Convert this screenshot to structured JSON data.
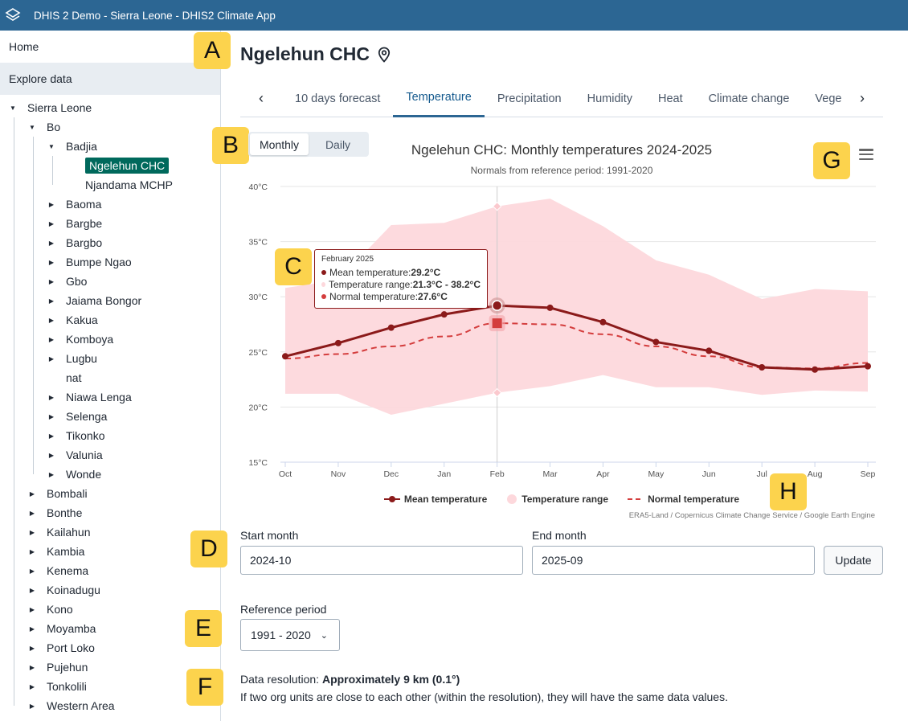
{
  "header": {
    "title": "DHIS 2 Demo - Sierra Leone - DHIS2 Climate App"
  },
  "sidebar": {
    "home": "Home",
    "explore": "Explore data",
    "tree": {
      "root": "Sierra Leone",
      "bo": "Bo",
      "badjia": "Badjia",
      "ngelehun": "Ngelehun CHC",
      "njandama": "Njandama MCHP",
      "bo_children": [
        "Baoma",
        "Bargbe",
        "Bargbo",
        "Bumpe Ngao",
        "Gbo",
        "Jaiama Bongor",
        "Kakua",
        "Komboya",
        "Lugbu",
        "nat",
        "Niawa Lenga",
        "Selenga",
        "Tikonko",
        "Valunia",
        "Wonde"
      ],
      "districts": [
        "Bombali",
        "Bonthe",
        "Kailahun",
        "Kambia",
        "Kenema",
        "Koinadugu",
        "Kono",
        "Moyamba",
        "Port Loko",
        "Pujehun",
        "Tonkolili",
        "Western Area"
      ]
    }
  },
  "badges": [
    "A",
    "B",
    "C",
    "D",
    "E",
    "F",
    "G",
    "H"
  ],
  "main": {
    "title": "Ngelehun CHC",
    "tabs": [
      "10 days forecast",
      "Temperature",
      "Precipitation",
      "Humidity",
      "Heat",
      "Climate change",
      "Vegeta"
    ],
    "active_tab": "Temperature",
    "toggle": {
      "monthly": "Monthly",
      "daily": "Daily"
    },
    "start_label": "Start month",
    "start_value": "2024-10",
    "end_label": "End month",
    "end_value": "2025-09",
    "update": "Update",
    "ref_label": "Reference period",
    "ref_value": "1991 - 2020",
    "res_prefix": "Data resolution: ",
    "res_value": "Approximately 9 km (0.1°)",
    "res_note": "If two org units are close to each other (within the resolution), they will have the same data values."
  },
  "tooltip": {
    "head": "February 2025",
    "mean_label": "Mean temperature: ",
    "mean_value": "29.2°C",
    "range_label": "Temperature range: ",
    "range_value": "21.3°C - 38.2°C",
    "normal_label": "Normal temperature: ",
    "normal_value": "27.6°C"
  },
  "colors": {
    "mean": "#8b1a1a",
    "range": "#fdd8dc",
    "normal": "#d43d3d",
    "header": "#2c6693",
    "selected": "#00695c"
  },
  "chart_data": {
    "type": "line",
    "title": "Ngelehun CHC: Monthly temperatures 2024-2025",
    "subtitle": "Normals from reference period: 1991-2020",
    "categories": [
      "Oct",
      "Nov",
      "Dec",
      "Jan",
      "Feb",
      "Mar",
      "Apr",
      "May",
      "Jun",
      "Jul",
      "Aug",
      "Sep"
    ],
    "yticks": [
      "15°C",
      "20°C",
      "25°C",
      "30°C",
      "35°C",
      "40°C"
    ],
    "ylim": [
      15,
      40
    ],
    "series": [
      {
        "name": "Mean temperature",
        "values": [
          24.6,
          25.8,
          27.2,
          28.4,
          29.2,
          29.0,
          27.7,
          25.9,
          25.1,
          23.6,
          23.4,
          23.7
        ]
      },
      {
        "name": "Temperature range",
        "low": [
          21.2,
          21.2,
          19.3,
          20.3,
          21.3,
          21.9,
          22.9,
          21.8,
          21.8,
          21.1,
          21.5,
          21.4
        ],
        "high": [
          30.8,
          31.5,
          36.5,
          36.7,
          38.2,
          38.9,
          36.4,
          33.3,
          32.0,
          29.8,
          30.7,
          30.5
        ]
      },
      {
        "name": "Normal temperature",
        "values": [
          24.4,
          24.8,
          25.5,
          26.4,
          27.6,
          27.5,
          26.6,
          25.5,
          24.6,
          23.6,
          23.5,
          24.0
        ]
      }
    ],
    "highlight_index": 4,
    "legend_position": "bottom",
    "credits": "ERA5-Land / Copernicus Climate Change Service / Google Earth Engine"
  }
}
